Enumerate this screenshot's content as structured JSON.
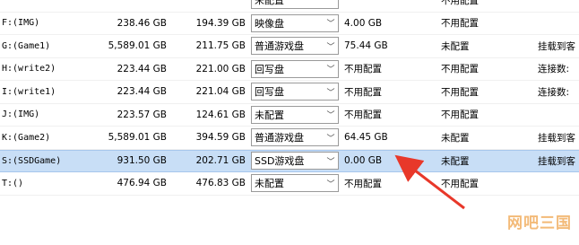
{
  "rows": [
    {
      "drive": "",
      "total": "",
      "free": "",
      "type": "未配置",
      "cache": "",
      "status": "不用配置",
      "extra": ""
    },
    {
      "drive": "F:(IMG)",
      "total": "238.46 GB",
      "free": "194.39 GB",
      "type": "映像盘",
      "cache": "4.00 GB",
      "status": "不用配置",
      "extra": ""
    },
    {
      "drive": "G:(Game1)",
      "total": "5,589.01 GB",
      "free": "211.75 GB",
      "type": "普通游戏盘",
      "cache": "75.44 GB",
      "status": "未配置",
      "extra": "挂载到客"
    },
    {
      "drive": "H:(write2)",
      "total": "223.44 GB",
      "free": "221.00 GB",
      "type": "回写盘",
      "cache": "不用配置",
      "status": "不用配置",
      "extra": "连接数:"
    },
    {
      "drive": "I:(write1)",
      "total": "223.44 GB",
      "free": "221.04 GB",
      "type": "回写盘",
      "cache": "不用配置",
      "status": "不用配置",
      "extra": "连接数:"
    },
    {
      "drive": "J:(IMG)",
      "total": "223.57 GB",
      "free": "124.61 GB",
      "type": "未配置",
      "cache": "不用配置",
      "status": "不用配置",
      "extra": ""
    },
    {
      "drive": "K:(Game2)",
      "total": "5,589.01 GB",
      "free": "394.59 GB",
      "type": "普通游戏盘",
      "cache": "64.45 GB",
      "status": "未配置",
      "extra": "挂载到客"
    },
    {
      "drive": "S:(SSDGame)",
      "total": "931.50 GB",
      "free": "202.71 GB",
      "type": "SSD游戏盘",
      "cache": "0.00 GB",
      "status": "未配置",
      "extra": "挂载到客",
      "selected": true
    },
    {
      "drive": "T:()",
      "total": "476.94 GB",
      "free": "476.83 GB",
      "type": "未配置",
      "cache": "不用配置",
      "status": "不用配置",
      "extra": ""
    }
  ],
  "annotation": {
    "color": "#e8382a"
  },
  "watermark": "网吧三国"
}
